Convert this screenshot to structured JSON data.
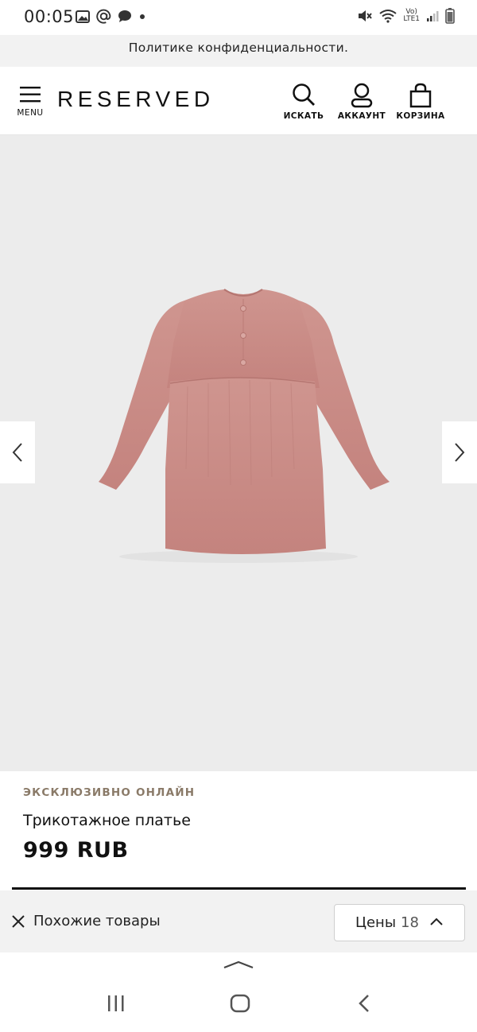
{
  "status_bar": {
    "time": "00:05",
    "lte_top": "Vo)",
    "lte_bottom": "LTE1"
  },
  "privacy_banner": {
    "text": "Политике конфиденциальности."
  },
  "header": {
    "logo": "RESERVED",
    "menu_label": "MENU",
    "search_label": "ИСКАТЬ",
    "account_label": "АККАУНТ",
    "cart_label": "КОРЗИНА"
  },
  "product": {
    "badge": "ЭКСКЛЮЗИВНО ОНЛАЙН",
    "title": "Трикотажное платье",
    "price": "999 RUB",
    "color": "#c98b86"
  },
  "filter_bar": {
    "similar_label": "Похожие товары",
    "prices_label": "Цены",
    "prices_count": "18"
  },
  "colors": {
    "banner_bg": "#f2f2f2",
    "gallery_bg": "#ececec",
    "badge_color": "#8a7a68"
  }
}
